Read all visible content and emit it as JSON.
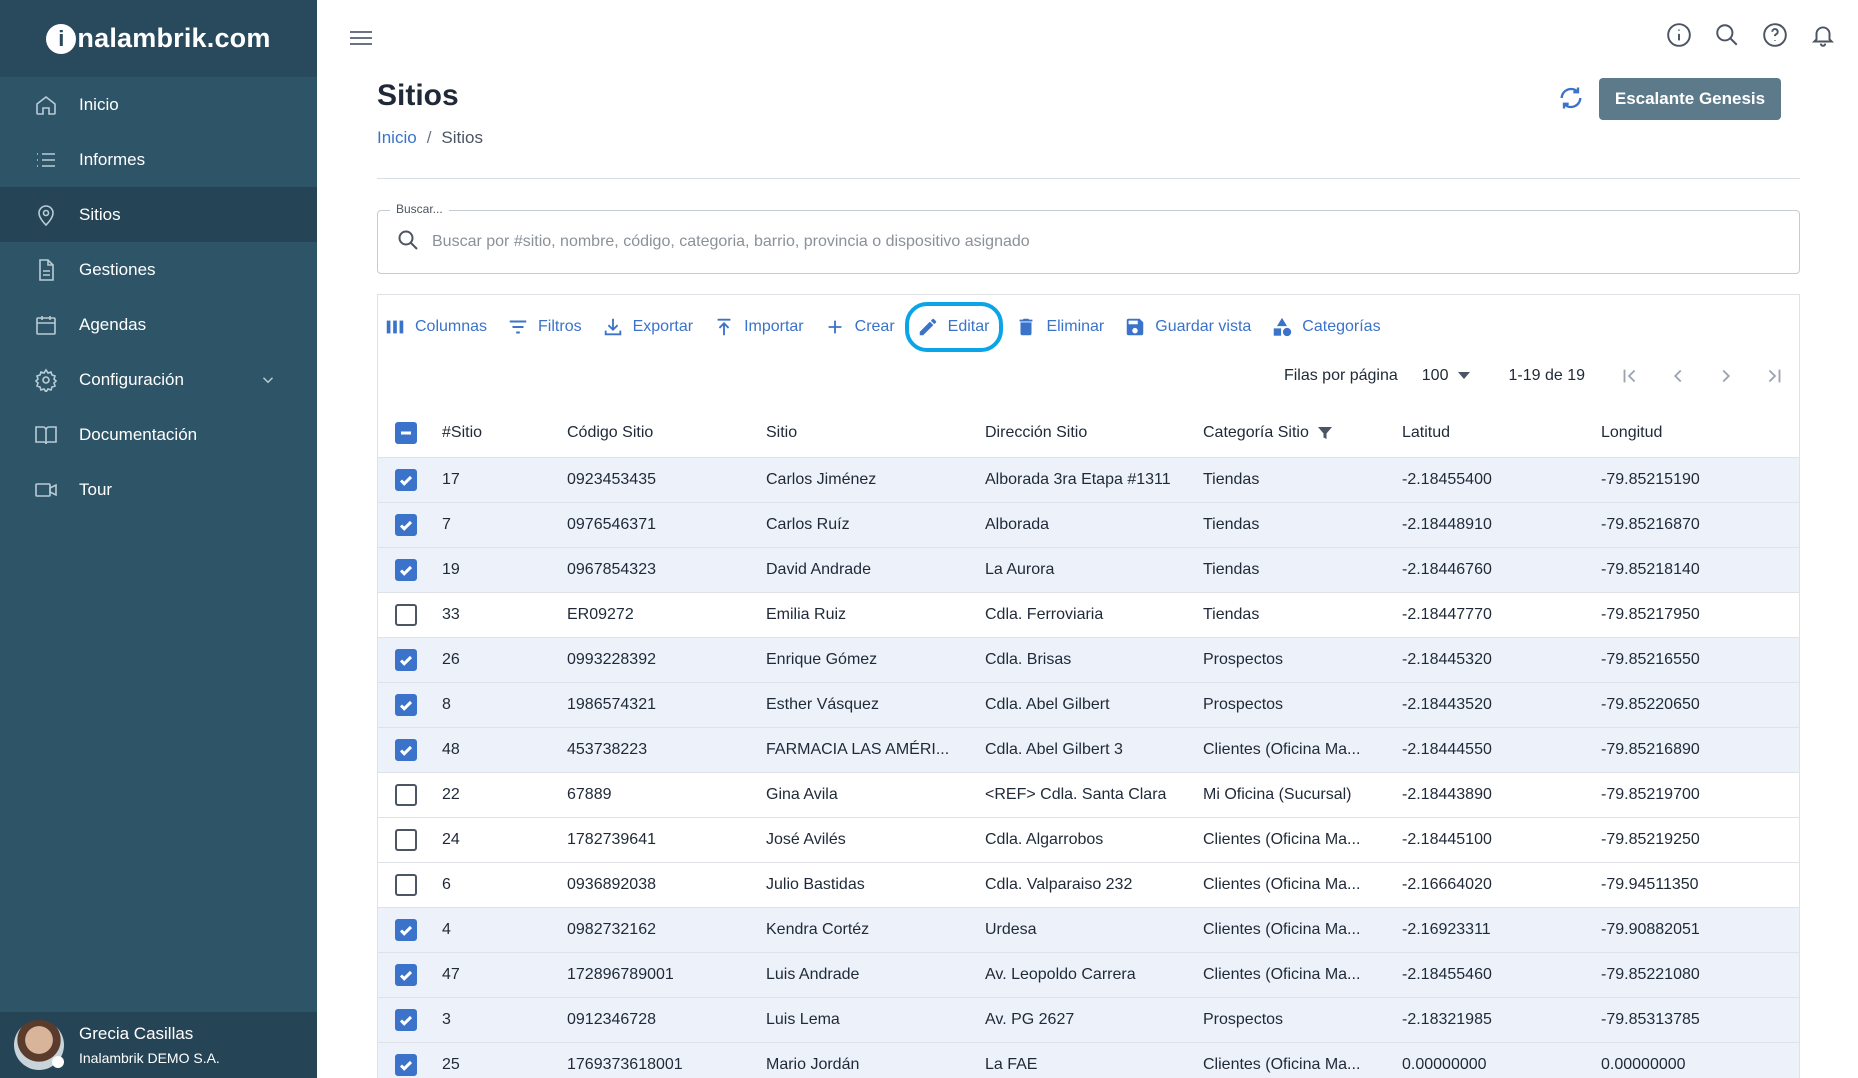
{
  "brand": {
    "logo_text": "nalambrik.com",
    "logo_i": "i"
  },
  "sidebar": {
    "items": [
      {
        "label": "Inicio",
        "icon": "home-icon"
      },
      {
        "label": "Informes",
        "icon": "list-icon"
      },
      {
        "label": "Sitios",
        "icon": "location-pin-icon",
        "active": true
      },
      {
        "label": "Gestiones",
        "icon": "document-icon"
      },
      {
        "label": "Agendas",
        "icon": "calendar-icon"
      },
      {
        "label": "Configuración",
        "icon": "gear-icon",
        "expandable": true
      },
      {
        "label": "Documentación",
        "icon": "book-icon"
      },
      {
        "label": "Tour",
        "icon": "video-icon"
      }
    ],
    "user": {
      "name": "Grecia Casillas",
      "company": "Inalambrik DEMO S.A."
    }
  },
  "header": {
    "title": "Sitios",
    "breadcrumb": {
      "home": "Inicio",
      "separator": "/",
      "current": "Sitios"
    },
    "company_button": "Escalante Genesis"
  },
  "search": {
    "legend": "Buscar...",
    "placeholder": "Buscar por #sitio, nombre, código, categoria, barrio, provincia o dispositivo asignado",
    "value": ""
  },
  "toolbar": {
    "columns": "Columnas",
    "filters": "Filtros",
    "export": "Exportar",
    "import": "Importar",
    "create": "Crear",
    "edit": "Editar",
    "delete": "Eliminar",
    "save_view": "Guardar vista",
    "categories": "Categorías"
  },
  "pager": {
    "rows_label": "Filas por página",
    "rows_value": "100",
    "range": "1-19 de 19"
  },
  "table": {
    "columns": [
      "#Sitio",
      "Código Sitio",
      "Sitio",
      "Dirección Sitio",
      "Categoría Sitio",
      "Latitud",
      "Longitud"
    ],
    "rows": [
      {
        "checked": true,
        "id": "17",
        "code": "0923453435",
        "site": "Carlos Jiménez",
        "address": "Alborada 3ra Etapa #1311",
        "category": "Tiendas",
        "lat": "-2.18455400",
        "lng": "-79.85215190"
      },
      {
        "checked": true,
        "id": "7",
        "code": "0976546371",
        "site": "Carlos Ruíz",
        "address": "Alborada",
        "category": "Tiendas",
        "lat": "-2.18448910",
        "lng": "-79.85216870"
      },
      {
        "checked": true,
        "id": "19",
        "code": "0967854323",
        "site": "David Andrade",
        "address": "La Aurora",
        "category": "Tiendas",
        "lat": "-2.18446760",
        "lng": "-79.85218140"
      },
      {
        "checked": false,
        "id": "33",
        "code": "ER09272",
        "site": "Emilia Ruiz",
        "address": "Cdla. Ferroviaria",
        "category": "Tiendas",
        "lat": "-2.18447770",
        "lng": "-79.85217950"
      },
      {
        "checked": true,
        "id": "26",
        "code": "0993228392",
        "site": "Enrique Gómez",
        "address": "Cdla. Brisas",
        "category": "Prospectos",
        "lat": "-2.18445320",
        "lng": "-79.85216550"
      },
      {
        "checked": true,
        "id": "8",
        "code": "1986574321",
        "site": "Esther Vásquez",
        "address": "Cdla. Abel Gilbert",
        "category": "Prospectos",
        "lat": "-2.18443520",
        "lng": "-79.85220650"
      },
      {
        "checked": true,
        "id": "48",
        "code": "453738223",
        "site": "FARMACIA LAS AMÉRI...",
        "address": "Cdla. Abel Gilbert 3",
        "category": "Clientes (Oficina Ma...",
        "lat": "-2.18444550",
        "lng": "-79.85216890"
      },
      {
        "checked": false,
        "id": "22",
        "code": "67889",
        "site": "Gina Avila",
        "address": "<REF> Cdla. Santa Clara",
        "category": "Mi Oficina (Sucursal)",
        "lat": "-2.18443890",
        "lng": "-79.85219700"
      },
      {
        "checked": false,
        "id": "24",
        "code": "1782739641",
        "site": "José Avilés",
        "address": "Cdla. Algarrobos",
        "category": "Clientes (Oficina Ma...",
        "lat": "-2.18445100",
        "lng": "-79.85219250"
      },
      {
        "checked": false,
        "id": "6",
        "code": "0936892038",
        "site": "Julio Bastidas",
        "address": "Cdla. Valparaiso 232",
        "category": "Clientes (Oficina Ma...",
        "lat": "-2.16664020",
        "lng": "-79.94511350"
      },
      {
        "checked": true,
        "id": "4",
        "code": "0982732162",
        "site": "Kendra Cortéz",
        "address": "Urdesa",
        "category": "Clientes (Oficina Ma...",
        "lat": "-2.16923311",
        "lng": "-79.90882051"
      },
      {
        "checked": true,
        "id": "47",
        "code": "172896789001",
        "site": "Luis Andrade",
        "address": "Av. Leopoldo Carrera",
        "category": "Clientes (Oficina Ma...",
        "lat": "-2.18455460",
        "lng": "-79.85221080"
      },
      {
        "checked": true,
        "id": "3",
        "code": "0912346728",
        "site": "Luis Lema",
        "address": "Av. PG 2627",
        "category": "Prospectos",
        "lat": "-2.18321985",
        "lng": "-79.85313785"
      },
      {
        "checked": true,
        "id": "25",
        "code": "1769373618001",
        "site": "Mario Jordán",
        "address": "La FAE",
        "category": "Clientes (Oficina Ma...",
        "lat": "0.00000000",
        "lng": "0.00000000"
      }
    ]
  },
  "colors": {
    "sidebar": "#2e5468",
    "accent": "#3a73c9",
    "highlight": "#0ba4e6",
    "selected_row": "#edf2fa"
  }
}
